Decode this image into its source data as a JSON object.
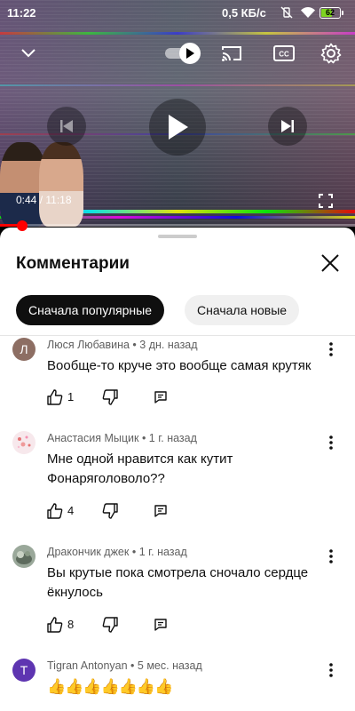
{
  "status_bar": {
    "time": "11:22",
    "network_speed": "0,5 КБ/с",
    "battery_level": "62",
    "battery_color": "#7ed321"
  },
  "player": {
    "time_current": "0:44",
    "time_separator": " / ",
    "time_total": "11:18",
    "progress_fraction": 0.065,
    "progress_color": "#ff0000",
    "icons": [
      "collapse-chevron-icon",
      "autoplay-toggle",
      "cast-icon",
      "captions-icon",
      "settings-gear-icon",
      "previous-icon",
      "play-icon",
      "next-icon",
      "fullscreen-icon"
    ]
  },
  "comments_panel": {
    "title": "Комментарии",
    "filters": {
      "top": "Сначала популярные",
      "newest": "Сначала новые"
    },
    "comments": [
      {
        "avatar_letter": "Л",
        "avatar_color": "#8d6e63",
        "author": "Люся Любавина",
        "age": "3 дн. назад",
        "text": "Вообще-то круче это вообще самая крутяк",
        "likes": "1"
      },
      {
        "avatar_letter": "",
        "avatar_color": "#f7e8ec",
        "author": "Анастасия Мыцик",
        "age": "1 г. назад",
        "text": "Мне одной нравится как кутит Фонаряголоволо??",
        "likes": "4"
      },
      {
        "avatar_letter": "",
        "avatar_color": "#9aa89a",
        "author": "Дракончик джек",
        "age": "1 г. назад",
        "text": "Вы крутые пока смотрела сночало сердце ёкнулось",
        "likes": "8"
      },
      {
        "avatar_letter": "T",
        "avatar_color": "#5e35b1",
        "author": "Tigran Antonyan",
        "age": "5 мес. назад",
        "text": "👍👍👍👍👍👍👍",
        "likes": ""
      }
    ],
    "meta_separator": " • "
  }
}
